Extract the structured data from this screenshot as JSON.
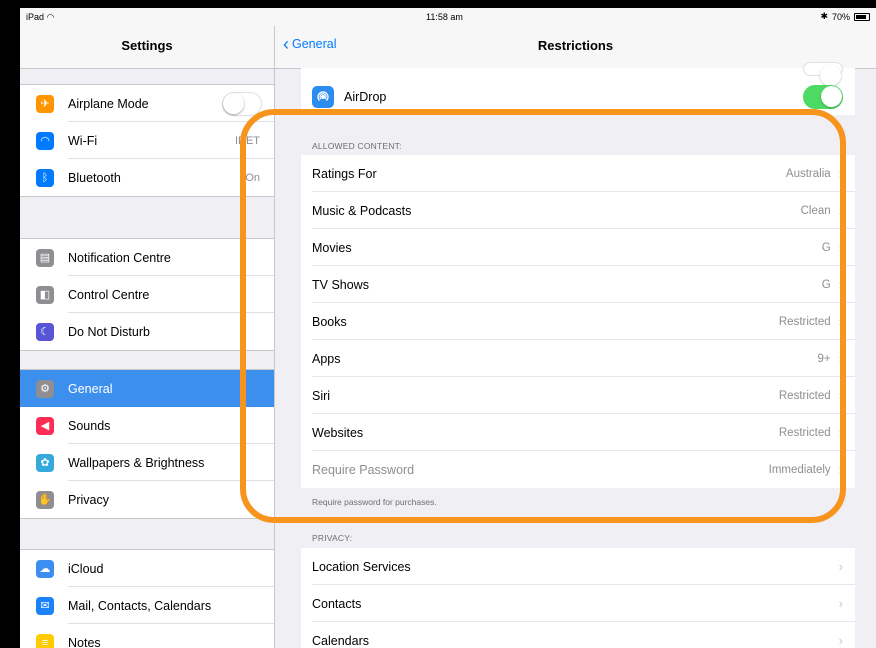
{
  "status_bar": {
    "device": "iPad",
    "wifi_icon": "wifi-icon",
    "time": "11:58 am",
    "battery_text": "70%"
  },
  "master": {
    "title": "Settings",
    "groups": [
      [
        {
          "label": "Airplane Mode",
          "icon": "airplane-icon",
          "color": "#ff9500",
          "toggle": "off"
        },
        {
          "label": "Wi-Fi",
          "value": "IDET",
          "icon": "wifi-icon",
          "color": "#007aff"
        },
        {
          "label": "Bluetooth",
          "value": "On",
          "icon": "bluetooth-icon",
          "color": "#007aff"
        }
      ],
      [
        {
          "label": "Notification Centre",
          "icon": "notification-centre-icon",
          "color": "#8e8e93"
        },
        {
          "label": "Control Centre",
          "icon": "control-centre-icon",
          "color": "#8e8e93"
        },
        {
          "label": "Do Not Disturb",
          "icon": "moon-icon",
          "color": "#5856d6"
        }
      ],
      [
        {
          "label": "General",
          "icon": "gear-icon",
          "color": "#8e8e93",
          "selected": true
        },
        {
          "label": "Sounds",
          "icon": "speaker-icon",
          "color": "#ff2d55"
        },
        {
          "label": "Wallpapers & Brightness",
          "icon": "flower-icon",
          "color": "#34aadc"
        },
        {
          "label": "Privacy",
          "icon": "hand-icon",
          "color": "#8e8e93"
        }
      ],
      [
        {
          "label": "iCloud",
          "icon": "cloud-icon",
          "color": "#3c8ef3"
        },
        {
          "label": "Mail, Contacts, Calendars",
          "icon": "mail-icon",
          "color": "#1a82fb"
        },
        {
          "label": "Notes",
          "icon": "notes-icon",
          "color": "#ffcc00"
        }
      ]
    ]
  },
  "detail": {
    "back_label": "General",
    "title": "Restrictions",
    "airdrop": {
      "label": "AirDrop",
      "toggle": "on",
      "icon": "airdrop-icon"
    },
    "allowed_content": {
      "header": "ALLOWED CONTENT:",
      "rows": [
        {
          "label": "Ratings For",
          "value": "Australia"
        },
        {
          "label": "Music & Podcasts",
          "value": "Clean"
        },
        {
          "label": "Movies",
          "value": "G"
        },
        {
          "label": "TV Shows",
          "value": "G"
        },
        {
          "label": "Books",
          "value": "Restricted"
        },
        {
          "label": "Apps",
          "value": "9+"
        },
        {
          "label": "Siri",
          "value": "Restricted"
        },
        {
          "label": "Websites",
          "value": "Restricted"
        },
        {
          "label": "Require Password",
          "value": "Immediately",
          "dim": true
        }
      ],
      "footer": "Require password for purchases."
    },
    "privacy": {
      "header": "PRIVACY:",
      "rows": [
        {
          "label": "Location Services"
        },
        {
          "label": "Contacts"
        },
        {
          "label": "Calendars"
        }
      ]
    }
  },
  "colors": {
    "highlight": "#f7941d",
    "accent": "#007aff",
    "toggle_on": "#4cd964"
  }
}
